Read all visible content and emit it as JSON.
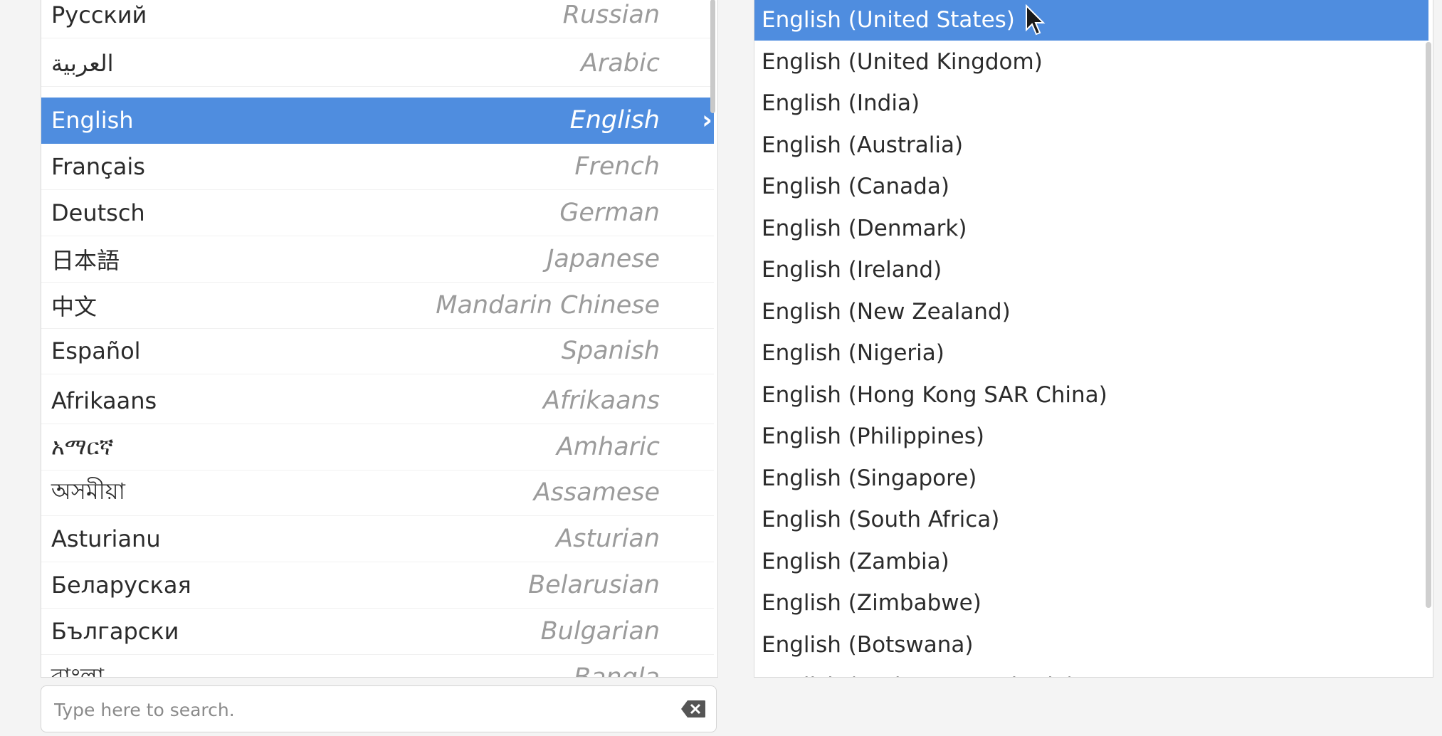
{
  "languages": [
    {
      "native": "Русский",
      "english": "Russian"
    },
    {
      "native": "العربية",
      "english": "Arabic"
    },
    {
      "native": "English",
      "english": "English",
      "selected": true
    },
    {
      "native": "Français",
      "english": "French"
    },
    {
      "native": "Deutsch",
      "english": "German"
    },
    {
      "native": "日本語",
      "english": "Japanese"
    },
    {
      "native": "中文",
      "english": "Mandarin Chinese"
    },
    {
      "native": "Español",
      "english": "Spanish"
    },
    {
      "native": "Afrikaans",
      "english": "Afrikaans"
    },
    {
      "native": "አማርኛ",
      "english": "Amharic"
    },
    {
      "native": "অসমীয়া",
      "english": "Assamese"
    },
    {
      "native": "Asturianu",
      "english": "Asturian"
    },
    {
      "native": "Беларуская",
      "english": "Belarusian"
    },
    {
      "native": "Български",
      "english": "Bulgarian"
    },
    {
      "native": "বাংলা",
      "english": "Bangla"
    }
  ],
  "locales": [
    {
      "label": "English (United States)",
      "selected": true
    },
    {
      "label": "English (United Kingdom)"
    },
    {
      "label": "English (India)"
    },
    {
      "label": "English (Australia)"
    },
    {
      "label": "English (Canada)"
    },
    {
      "label": "English (Denmark)"
    },
    {
      "label": "English (Ireland)"
    },
    {
      "label": "English (New Zealand)"
    },
    {
      "label": "English (Nigeria)"
    },
    {
      "label": "English (Hong Kong SAR China)"
    },
    {
      "label": "English (Philippines)"
    },
    {
      "label": "English (Singapore)"
    },
    {
      "label": "English (South Africa)"
    },
    {
      "label": "English (Zambia)"
    },
    {
      "label": "English (Zimbabwe)"
    },
    {
      "label": "English (Botswana)"
    },
    {
      "label": "English (Antigua & Barbuda)"
    }
  ],
  "search": {
    "placeholder": "Type here to search."
  },
  "icons": {
    "selected_chevron": "chevron-right-icon",
    "clear": "clear-search-icon",
    "pointer": "mouse-pointer-icon"
  },
  "colors": {
    "selection": "#4f8ddf"
  }
}
